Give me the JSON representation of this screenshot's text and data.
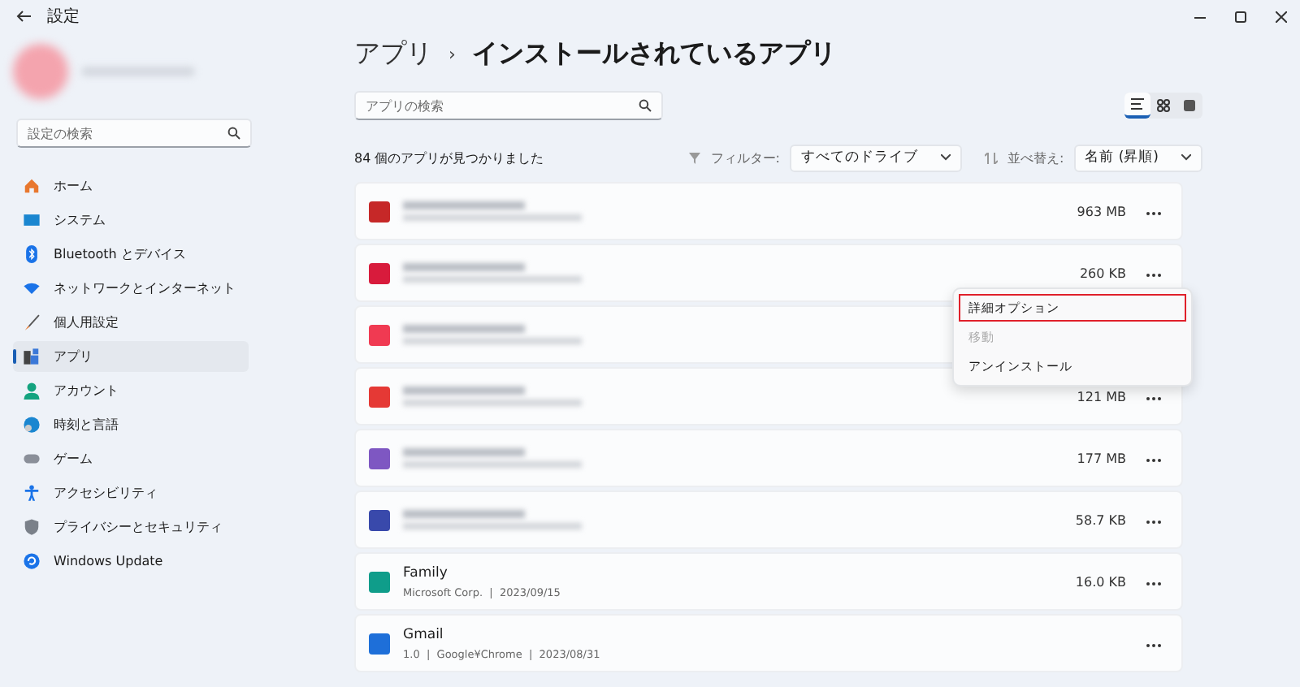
{
  "window": {
    "title": "設定"
  },
  "account": {
    "blurred": true
  },
  "sidebar": {
    "search": {
      "placeholder": "設定の検索"
    },
    "items": [
      {
        "label": "ホーム",
        "kind": "home",
        "selected": false
      },
      {
        "label": "システム",
        "kind": "system",
        "selected": false
      },
      {
        "label": "Bluetooth とデバイス",
        "kind": "bluetooth",
        "selected": false
      },
      {
        "label": "ネットワークとインターネット",
        "kind": "wifi",
        "selected": false
      },
      {
        "label": "個人用設定",
        "kind": "brush",
        "selected": false
      },
      {
        "label": "アプリ",
        "kind": "apps",
        "selected": true
      },
      {
        "label": "アカウント",
        "kind": "person",
        "selected": false
      },
      {
        "label": "時刻と言語",
        "kind": "globe",
        "selected": false
      },
      {
        "label": "ゲーム",
        "kind": "game",
        "selected": false
      },
      {
        "label": "アクセシビリティ",
        "kind": "access",
        "selected": false
      },
      {
        "label": "プライバシーとセキュリティ",
        "kind": "shield",
        "selected": false
      },
      {
        "label": "Windows Update",
        "kind": "update",
        "selected": false
      }
    ]
  },
  "breadcrumb": {
    "parent": "アプリ",
    "separator": "›",
    "current": "インストールされているアプリ"
  },
  "search": {
    "placeholder": "アプリの検索"
  },
  "view_modes": [
    {
      "kind": "list",
      "selected": true
    },
    {
      "kind": "grid",
      "selected": false
    },
    {
      "kind": "table",
      "selected": false
    }
  ],
  "count": "84 個のアプリが見つかりました",
  "filter": {
    "label": "フィルター:",
    "value": "すべてのドライブ"
  },
  "sort": {
    "label": "並べ替え:",
    "value": "名前 (昇順)"
  },
  "apps": [
    {
      "blurred": true,
      "color": "#c62828",
      "size": "963 MB"
    },
    {
      "blurred": true,
      "color": "#d81b3c",
      "size": "260 KB"
    },
    {
      "blurred": true,
      "color": "#f03a52",
      "covered": true
    },
    {
      "blurred": true,
      "color": "#e53935",
      "size": "121 MB"
    },
    {
      "blurred": true,
      "color": "#7e57c2",
      "size": "177 MB"
    },
    {
      "blurred": true,
      "color": "#3949ab",
      "size": "58.7 KB"
    },
    {
      "blurred": false,
      "color": "#0f9d8a",
      "name": "Family",
      "details": "Microsoft Corp.  |  2023/09/15",
      "size": "16.0 KB"
    },
    {
      "blurred": false,
      "color": "#1e6fd9",
      "name": "Gmail",
      "details": "1.0  |  Google¥Chrome  |  2023/08/31"
    }
  ],
  "context_menu": {
    "items": [
      {
        "label": "詳細オプション",
        "disabled": false,
        "highlighted": true
      },
      {
        "label": "移動",
        "disabled": true,
        "highlighted": false
      },
      {
        "label": "アンインストール",
        "disabled": false,
        "highlighted": false
      }
    ]
  }
}
